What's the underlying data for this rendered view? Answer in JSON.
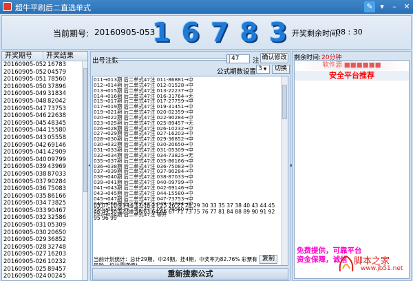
{
  "window": {
    "title": "超牛平刷后二直选单式"
  },
  "header": {
    "period_label": "当前期号:",
    "period_value": "20160905-053",
    "big_number": "16783",
    "remain_label": "开奖剩余时间：",
    "remain_value": "08 : 30"
  },
  "left_table": {
    "col1": "开奖期号",
    "col2": "开奖结果",
    "rows": [
      [
        "20160905-052",
        "16783"
      ],
      [
        "20160905-052",
        "04579"
      ],
      [
        "20160905-051",
        "78560"
      ],
      [
        "20160905-050",
        "37896"
      ],
      [
        "20160905-049",
        "31834"
      ],
      [
        "20160905-048",
        "82042"
      ],
      [
        "20160905-047",
        "73753"
      ],
      [
        "20160905-046",
        "22638"
      ],
      [
        "20160905-045",
        "48345"
      ],
      [
        "20160905-044",
        "15580"
      ],
      [
        "20160905-043",
        "05558"
      ],
      [
        "20160905-042",
        "69146"
      ],
      [
        "20160905-041",
        "42909"
      ],
      [
        "20160905-040",
        "09799"
      ],
      [
        "20160905-039",
        "43969"
      ],
      [
        "20160905-038",
        "87033"
      ],
      [
        "20160905-037",
        "90284"
      ],
      [
        "20160905-036",
        "75083"
      ],
      [
        "20160905-035",
        "86166"
      ],
      [
        "20160905-034",
        "73825"
      ],
      [
        "20160905-033",
        "90467"
      ],
      [
        "20160905-032",
        "32586"
      ],
      [
        "20160905-031",
        "05309"
      ],
      [
        "20160905-030",
        "20650"
      ],
      [
        "20160905-029",
        "36852"
      ],
      [
        "20160905-028",
        "32748"
      ],
      [
        "20160905-027",
        "16203"
      ],
      [
        "20160905-026",
        "10232"
      ],
      [
        "20160905-025",
        "89457"
      ],
      [
        "20160905-024",
        "00245"
      ]
    ]
  },
  "middle": {
    "count_label": "出号注数",
    "count_value": "47",
    "count_unit": "注",
    "confirm_label": "确认修改",
    "formula_label": "公式期数设置：",
    "formula_value": "3",
    "switch_label": "切换",
    "results_lines": [
      "011→013期 后二单式47注 011-86881→中",
      "012→014期 后二单式47注 012-01528→中",
      "013→015期 后二单式47注 013-22237→中",
      "014→016期 后二单式47注 016-31764→无",
      "015→017期 后二单式47注 017-27759→中",
      "017→019期 后二单式47注 019-31451→中",
      "019→021期 后二单式47注 020-02359→中",
      "020→022期 后二单式47注 022-90284→中",
      "023→025期 后二单式47注 025-89457→无",
      "026→028期 后二单式47注 026-10232→中",
      "027→029期 后二单式47注 027-16203→中",
      "028→030期 后二单式47注 029-36852→中",
      "030→032期 后二单式47注 030-20650→中",
      "031→033期 后二单式47注 031-05309→中",
      "032→034期 后二单式47注 034-73825→无",
      "035→037期 后二单式47注 035-86166→中",
      "036→038期 后二单式47注 036-75083→中",
      "037→039期 后二单式47注 037-90284→中",
      "038→040期 后二单式47注 038-87033→中",
      "039→041期 后二单式47注 040-09799→中",
      "041→043期 后二单式47注 042-69146→中",
      "043→045期 后二单式47注 044-15580→中",
      "045→047期 后二单式47注 047-73753→中",
      "048→050期 后二单式47注 049-31834→中",
      "050→052期 后二单式47注 051-78560→中",
      "052→054期 后二单式47注 等开"
    ],
    "numbers_text": "03 07 10 13 16 17 18 23 25 26 27 28 29 30 33 35 37 38 40 43 44 45 46 49 50 52 56 58 63 64 66 67 71 73 75 76 77 81 84 88 89 90 91 92 95 96 99",
    "summary_text": "当前计划统计：总计29期，中24期，挂4期，中奖率为82.76% 彩票有风险，投注需谨慎！",
    "copy_label": "复制",
    "search_label": "重新搜索公式"
  },
  "right": {
    "time_label": "剩余时间:",
    "time_value": "20分钟",
    "ad_top": "软件源 ■■■■■■",
    "ad_title": "安全平台推荐",
    "foot1": "免费提供，可靠平台",
    "foot2": "资金保障，诚信",
    "watermark1": "脚本之家",
    "watermark2": "www.jb51.net"
  }
}
